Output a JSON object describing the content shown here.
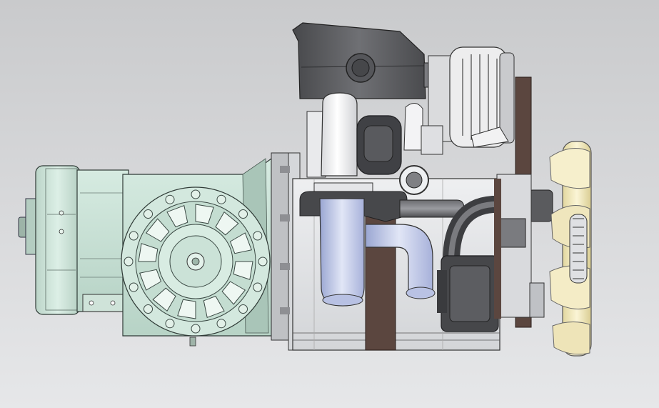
{
  "scene": {
    "subject": "engine-assembly-cad-render",
    "colors": {
      "background_top": "#c9cacc",
      "background_bottom": "#e6e7e9",
      "gearbox": "#c8e0d4",
      "gearbox_dark": "#9fbcb0",
      "block": "#e4e5e7",
      "dark_metal": "#5a5b5e",
      "turbo": "#f2f2f4",
      "intake_pipe": "#c8d0ea",
      "belt": "#5b463f",
      "fan": "#f0e8bc"
    }
  }
}
